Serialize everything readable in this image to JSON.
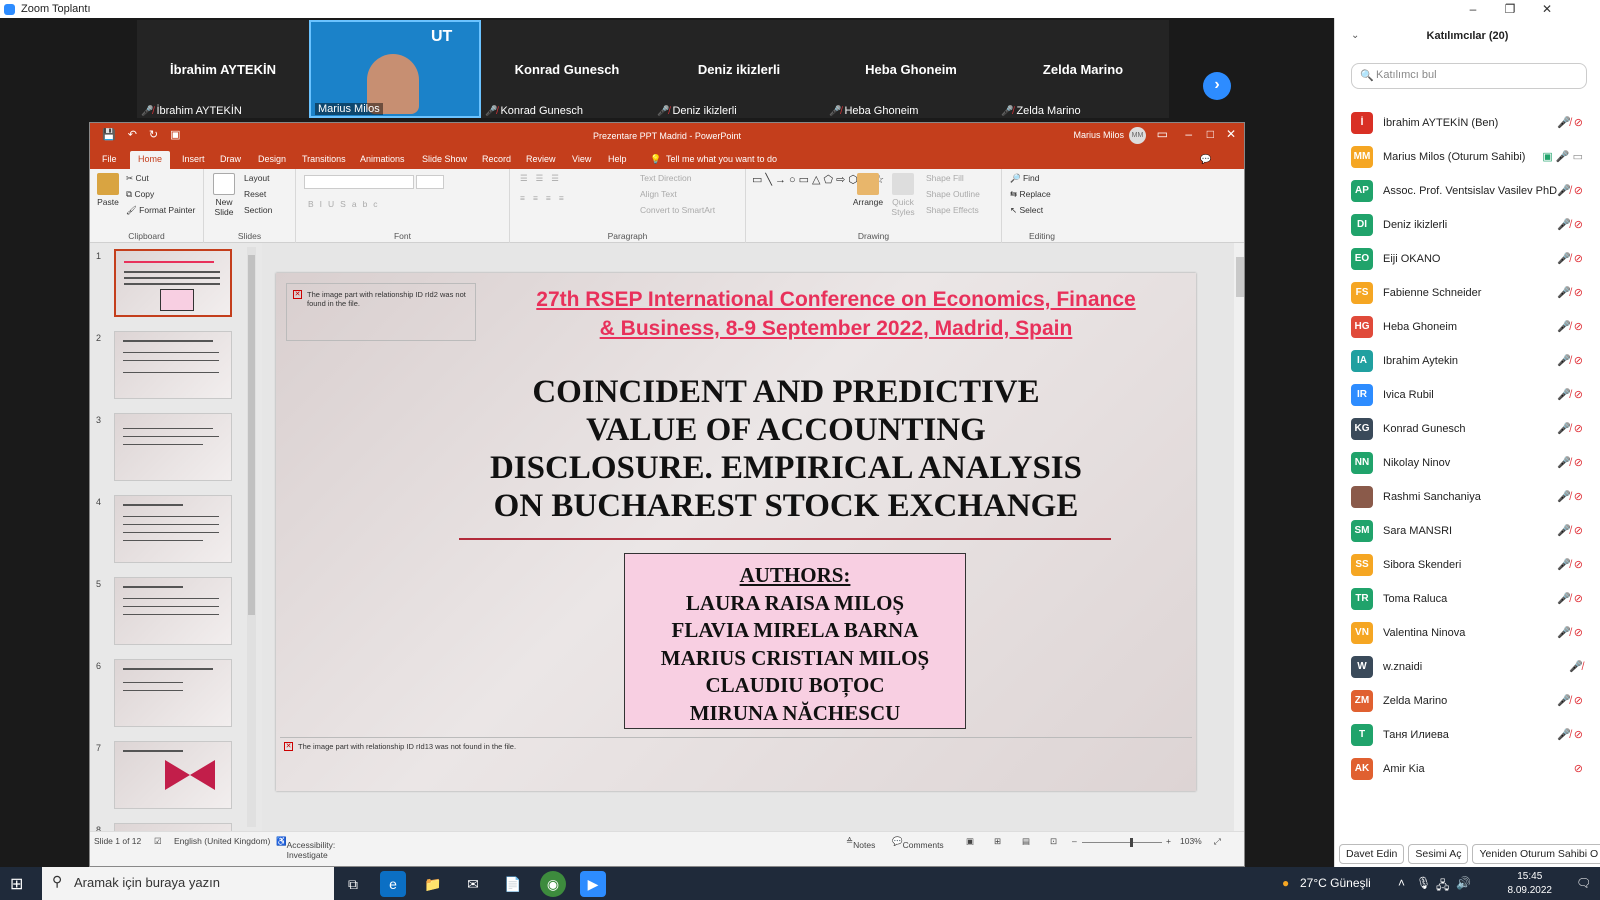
{
  "window": {
    "title": "Zoom Toplantı",
    "minimize": "–",
    "restore": "❐",
    "close": "✕"
  },
  "video_strip": {
    "tiles": [
      {
        "name": "İbrahim AYTEKİN",
        "label": "İbrahim AYTEKİN"
      },
      {
        "name": "",
        "label": "Marius Milos"
      },
      {
        "name": "Konrad Gunesch",
        "label": "Konrad Gunesch"
      },
      {
        "name": "Deniz ikizlerli",
        "label": "Deniz ikizlerli"
      },
      {
        "name": "Heba Ghoneim",
        "label": "Heba Ghoneim"
      },
      {
        "name": "Zelda Marino",
        "label": "Zelda Marino"
      }
    ],
    "next_icon": "›"
  },
  "ppt": {
    "title": "Prezentare PPT Madrid  -  PowerPoint",
    "user": "Marius Milos",
    "user_initials": "MM",
    "tabs": [
      "File",
      "Home",
      "Insert",
      "Draw",
      "Design",
      "Transitions",
      "Animations",
      "Slide Show",
      "Record",
      "Review",
      "View",
      "Help"
    ],
    "tell_me": "Tell me what you want to do",
    "ribbon": {
      "clipboard": {
        "paste": "Paste",
        "cut": "Cut",
        "copy": "Copy",
        "format_painter": "Format Painter",
        "label": "Clipboard"
      },
      "slides": {
        "new_slide": "New Slide",
        "layout": "Layout",
        "reset": "Reset",
        "section": "Section",
        "label": "Slides"
      },
      "font": {
        "label": "Font"
      },
      "paragraph": {
        "text_direction": "Text Direction",
        "align_text": "Align Text",
        "convert": "Convert to SmartArt",
        "label": "Paragraph"
      },
      "drawing": {
        "arrange": "Arrange",
        "quick_styles": "Quick Styles",
        "shape_fill": "Shape Fill",
        "shape_outline": "Shape Outline",
        "shape_effects": "Shape Effects",
        "label": "Drawing"
      },
      "editing": {
        "find": "Find",
        "replace": "Replace",
        "select": "Select",
        "label": "Editing"
      }
    },
    "thumbnails": [
      "1",
      "2",
      "3",
      "4",
      "5",
      "6",
      "7",
      "8"
    ],
    "slide": {
      "broken_image_1": "The image part with relationship ID rId2 was not found in the file.",
      "broken_image_2": "The image part with relationship ID rId13 was not found in the file.",
      "conference_line1": "27th RSEP International Conference on Economics, Finance",
      "conference_line2": "& Business, 8-9 September 2022, Madrid, Spain",
      "title_lines": [
        "COINCIDENT  AND PREDICTIVE",
        "VALUE OF ACCOUNTING",
        "DISCLOSURE. EMPIRICAL ANALYSIS",
        "ON BUCHAREST STOCK EXCHANGE"
      ],
      "authors_heading": "AUTHORS:",
      "authors": [
        "LAURA RAISA MILOȘ",
        "FLAVIA MIRELA BARNA",
        "MARIUS CRISTIAN MILOȘ",
        "CLAUDIU BOȚOC",
        "MIRUNA NĂCHESCU"
      ]
    },
    "status": {
      "slide_of": "Slide 1 of 12",
      "language": "English (United Kingdom)",
      "accessibility": "Accessibility: Investigate",
      "notes": "Notes",
      "comments": "Comments",
      "zoom": "103%",
      "zoom_fraction": 0.6
    }
  },
  "participants": {
    "header": "Katılımcılar (20)",
    "search_placeholder": "Katılımcı bul",
    "list": [
      {
        "initials": "İ",
        "name": "İbrahim AYTEKİN (Ben)",
        "color": "#d93025",
        "mic": "off",
        "cam": "off"
      },
      {
        "initials": "MM",
        "name": "Marius Milos (Oturum Sahibi)",
        "color": "#f5a623",
        "mic": "on",
        "cam": "on",
        "sharing": true
      },
      {
        "initials": "AP",
        "name": "Assoc. Prof. Ventsislav Vasilev PhD",
        "color": "#20a36b",
        "mic": "off",
        "cam": "off"
      },
      {
        "initials": "DI",
        "name": "Deniz ikizlerli",
        "color": "#20a36b",
        "mic": "off",
        "cam": "off"
      },
      {
        "initials": "EO",
        "name": "Eiji OKANO",
        "color": "#20a36b",
        "mic": "off",
        "cam": "off"
      },
      {
        "initials": "FS",
        "name": "Fabienne Schneider",
        "color": "#f5a623",
        "mic": "off",
        "cam": "off"
      },
      {
        "initials": "HG",
        "name": "Heba Ghoneim",
        "color": "#e04a3a",
        "mic": "off",
        "cam": "off"
      },
      {
        "initials": "IA",
        "name": "Ibrahim Aytekin",
        "color": "#20a0a0",
        "mic": "off",
        "cam": "off"
      },
      {
        "initials": "IR",
        "name": "Ivica Rubil",
        "color": "#2d8cff",
        "mic": "off",
        "cam": "off"
      },
      {
        "initials": "KG",
        "name": "Konrad Gunesch",
        "color": "#3a4a5a",
        "mic": "off",
        "cam": "off"
      },
      {
        "initials": "NN",
        "name": "Nikolay Ninov",
        "color": "#20a36b",
        "mic": "off",
        "cam": "off"
      },
      {
        "initials": "",
        "name": "Rashmi Sanchaniya",
        "color": "#8a5a4a",
        "mic": "off",
        "cam": "off"
      },
      {
        "initials": "SM",
        "name": "Sara MANSRI",
        "color": "#20a36b",
        "mic": "off",
        "cam": "off"
      },
      {
        "initials": "SS",
        "name": "Sibora Skenderi",
        "color": "#f5a623",
        "mic": "off",
        "cam": "off"
      },
      {
        "initials": "TR",
        "name": "Toma Raluca",
        "color": "#20a36b",
        "mic": "off",
        "cam": "off"
      },
      {
        "initials": "VN",
        "name": "Valentina Ninova",
        "color": "#f5a623",
        "mic": "off",
        "cam": "off"
      },
      {
        "initials": "W",
        "name": "w.znaidi",
        "color": "#3a4a5a",
        "mic": "off",
        "cam": "none"
      },
      {
        "initials": "ZM",
        "name": "Zelda Marino",
        "color": "#e06030",
        "mic": "off",
        "cam": "off"
      },
      {
        "initials": "T",
        "name": "Таня Илиева",
        "color": "#20a36b",
        "mic": "off",
        "cam": "off"
      },
      {
        "initials": "AK",
        "name": "Amir Kia",
        "color": "#e06030",
        "mic": "none",
        "cam": "off"
      }
    ],
    "buttons": {
      "invite": "Davet Edin",
      "unmute": "Sesimi Aç",
      "reclaim": "Yeniden Oturum Sahibi O"
    }
  },
  "taskbar": {
    "search_placeholder": "Aramak için buraya yazın",
    "weather": "27°C  Güneşli",
    "time": "15:45",
    "date": "8.09.2022"
  }
}
